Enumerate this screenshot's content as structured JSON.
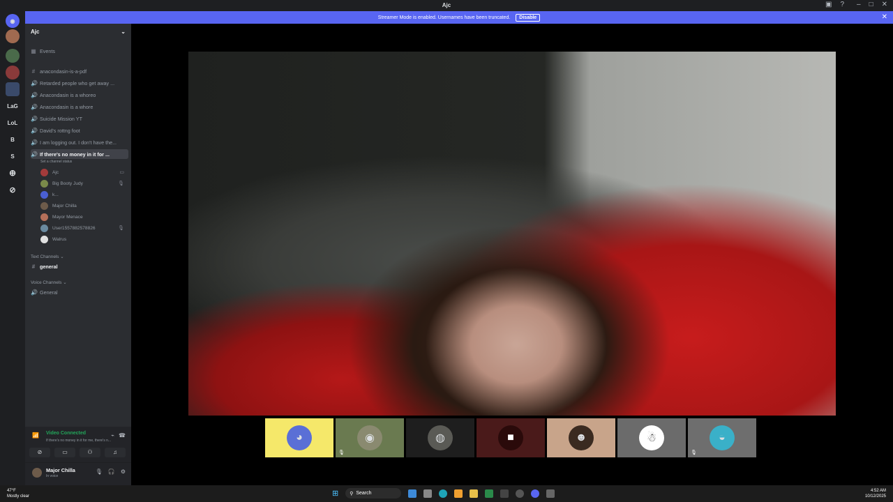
{
  "window": {
    "title": "Ajc"
  },
  "banner": {
    "text": "Streamer Mode is enabled. Usernames have been truncated.",
    "button": "Disable"
  },
  "guilds": [
    "LaG",
    "LoL",
    "B",
    "S"
  ],
  "server": {
    "name": "Ajc"
  },
  "events_label": "Events",
  "channels": [
    {
      "icon": "#",
      "label": "anacondasin-is-a-pdf"
    },
    {
      "icon": "🔊",
      "label": "Retarded people who get away ..."
    },
    {
      "icon": "🔊",
      "label": "Anacondasin is a whoreo"
    },
    {
      "icon": "🔊",
      "label": "Anacondasin is a whore"
    },
    {
      "icon": "🔊",
      "label": "Suicide Mission YT"
    },
    {
      "icon": "🔊",
      "label": "David's rottng foot"
    },
    {
      "icon": "🔊",
      "label": "I am logging out. I don't have the..."
    },
    {
      "icon": "🔊",
      "label": "If there's no money in it for ..."
    }
  ],
  "active_channel_status": "Set a channel status",
  "members": [
    {
      "name": "Ajc",
      "color": "#a33b3b",
      "trail": "▭"
    },
    {
      "name": "Big Booty Judy",
      "color": "#7a8a4a",
      "trail": "🎙"
    },
    {
      "name": "k...",
      "color": "#4a5fd1",
      "trail": ""
    },
    {
      "name": "Major Chilla",
      "color": "#6d5b4a",
      "trail": ""
    },
    {
      "name": "Mayor Menace",
      "color": "#b5705a",
      "trail": ""
    },
    {
      "name": "User1557882578826",
      "color": "#6a8aa0",
      "trail": "🎙"
    },
    {
      "name": "Walrus",
      "color": "#e0e0e0",
      "trail": ""
    }
  ],
  "categories": {
    "text": "Text Channels",
    "text_channel": "general",
    "voice": "Voice Channels",
    "voice_channel": "General"
  },
  "voice_status": {
    "title": "Video Connected",
    "subtitle": "If there's no money in it for me, there's n..."
  },
  "user": {
    "name": "Major Chilla",
    "status": "In voice"
  },
  "tiles": [
    {
      "bg": "#f5e86a",
      "face": "#5a6fd6",
      "glyph": "◕",
      "muted": false
    },
    {
      "bg": "#6a7a50",
      "face": "#8a8a70",
      "glyph": "◉",
      "muted": true
    },
    {
      "bg": "#1e1e1e",
      "face": "#5a5a55",
      "glyph": "◍",
      "muted": false
    },
    {
      "bg": "#4a1a1a",
      "face": "#2a0a0a",
      "glyph": "■",
      "muted": false
    },
    {
      "bg": "#c8a48a",
      "face": "#3a2a20",
      "glyph": "☻",
      "muted": false
    },
    {
      "bg": "#6b6b6b",
      "face": "#ffffff",
      "glyph": "☃",
      "muted": false
    },
    {
      "bg": "#6e6e6e",
      "face": "#3ab0c8",
      "glyph": "◒",
      "muted": true
    }
  ],
  "taskbar": {
    "temp": "47°F",
    "weather": "Mostly clear",
    "search": "Search",
    "time": "4:52 AM",
    "date": "10/12/2025"
  }
}
